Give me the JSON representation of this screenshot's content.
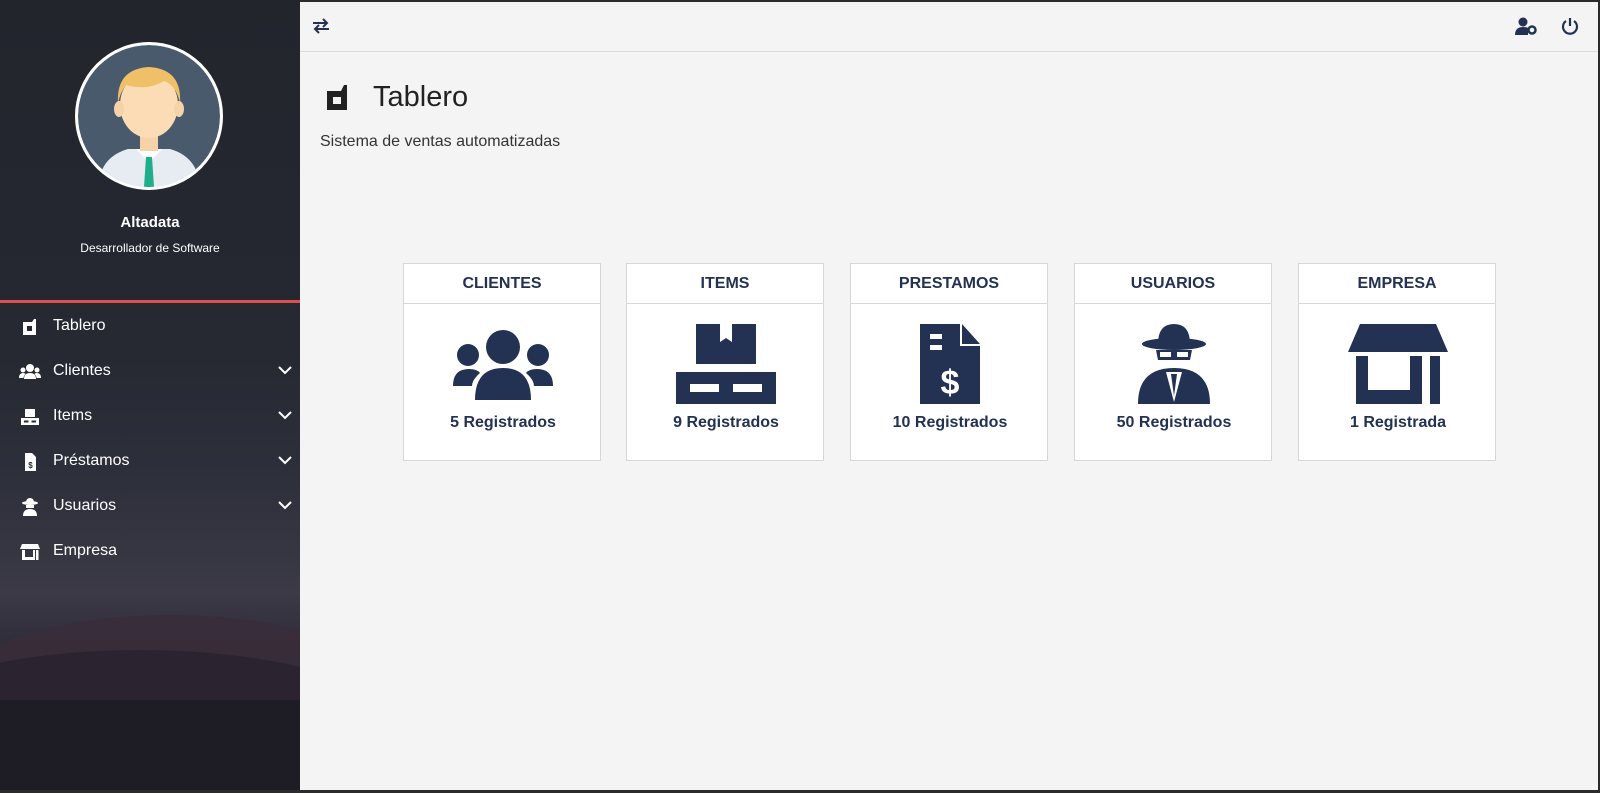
{
  "profile": {
    "name": "Altadata",
    "role": "Desarrollador de Software"
  },
  "nav": {
    "items": [
      {
        "label": "Tablero",
        "icon": "dashboard-icon",
        "expandable": false
      },
      {
        "label": "Clientes",
        "icon": "users-icon",
        "expandable": true
      },
      {
        "label": "Items",
        "icon": "pallet-icon",
        "expandable": true
      },
      {
        "label": "Préstamos",
        "icon": "invoice-dollar-icon",
        "expandable": true
      },
      {
        "label": "Usuarios",
        "icon": "user-secret-icon",
        "expandable": true
      },
      {
        "label": "Empresa",
        "icon": "store-icon",
        "expandable": false
      }
    ]
  },
  "topbar": {
    "left_icon": "exchange-icon",
    "right_icons": [
      "user-cog-icon",
      "power-icon"
    ]
  },
  "page": {
    "title": "Tablero",
    "subtitle": "Sistema de ventas automatizadas"
  },
  "tiles": [
    {
      "header": "CLIENTES",
      "count": "5 Registrados",
      "icon": "users-icon"
    },
    {
      "header": "ITEMS",
      "count": "9 Registrados",
      "icon": "pallet-icon"
    },
    {
      "header": "PRESTAMOS",
      "count": "10 Registrados",
      "icon": "invoice-dollar-icon"
    },
    {
      "header": "USUARIOS",
      "count": "50 Registrados",
      "icon": "user-secret-icon"
    },
    {
      "header": "EMPRESA",
      "count": "1 Registrada",
      "icon": "store-icon"
    }
  ],
  "colors": {
    "accent": "#e04e4e",
    "icon": "#233252",
    "sidebar": "#25272f"
  }
}
